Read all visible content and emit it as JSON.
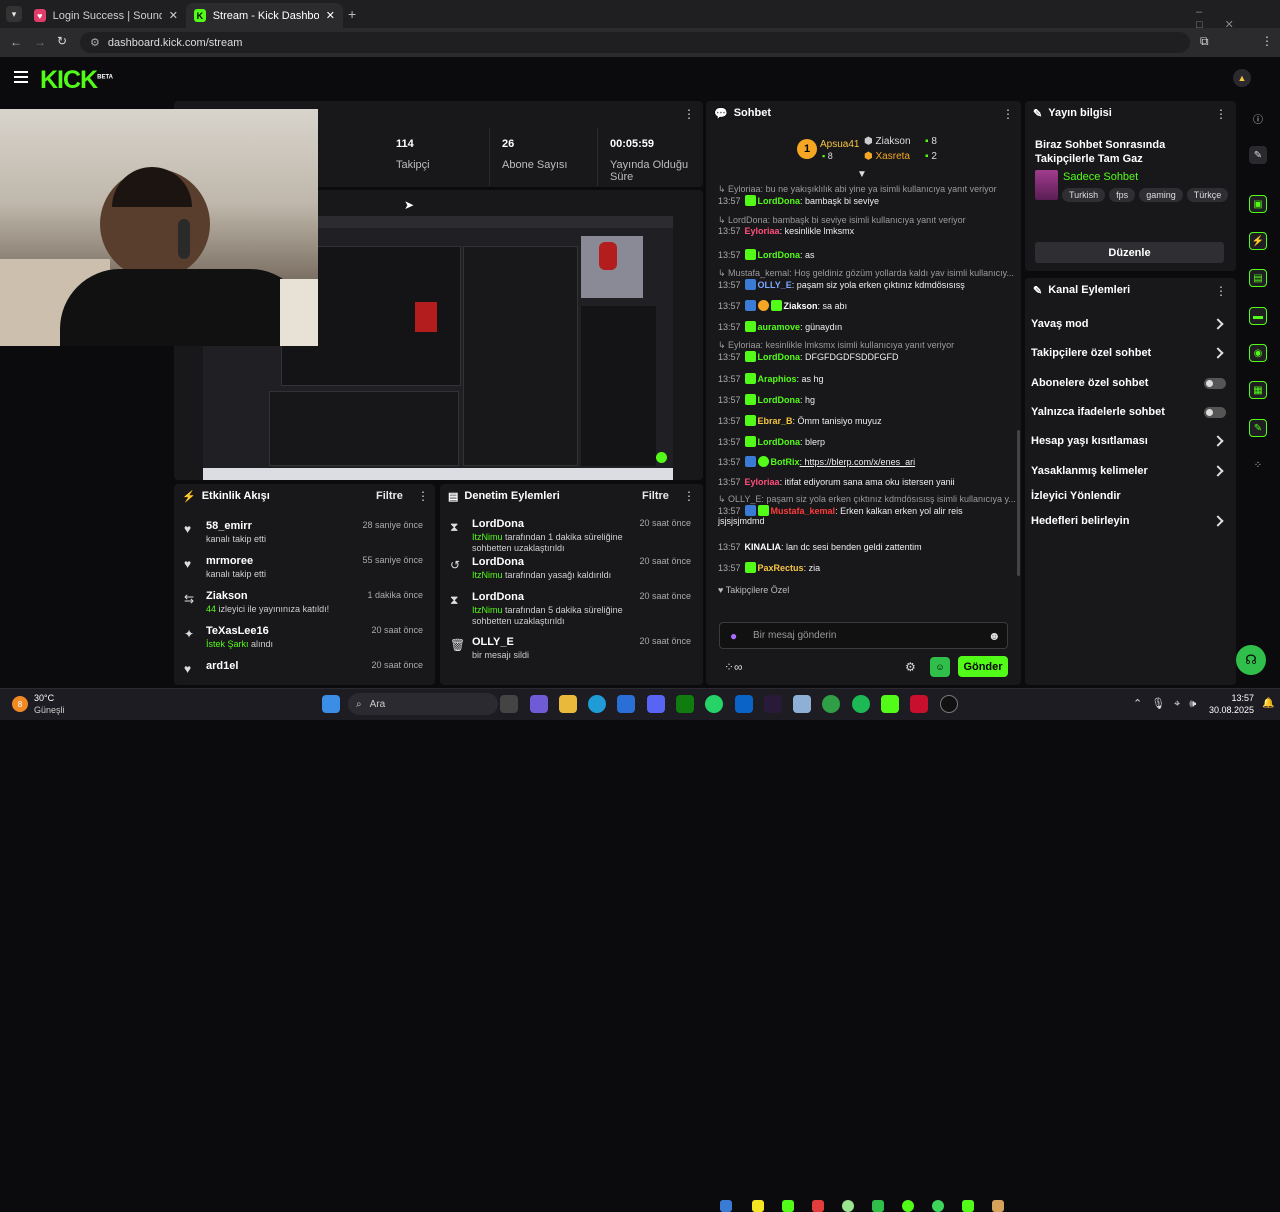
{
  "browser": {
    "tabs": [
      {
        "title": "Login Success | Soundboard Bro"
      },
      {
        "title": "Stream - Kick Dashboard"
      }
    ],
    "url": "dashboard.kick.com/stream"
  },
  "site": {
    "logo": "KICK",
    "logo_badge": "BETA"
  },
  "stats": [
    {
      "value": "114",
      "label": "Takipçi"
    },
    {
      "value": "26",
      "label": "Abone Sayısı"
    },
    {
      "value": "00:05:59",
      "label": "Yayında Olduğu Süre"
    }
  ],
  "activity": {
    "title": "Etkinlik Akışı",
    "filter": "Filtre",
    "items": [
      {
        "icon": "heart-icon",
        "name": "58_emirr",
        "time": "28 saniye önce",
        "desc": "kanalı takip etti",
        "highlight": ""
      },
      {
        "icon": "heart-icon",
        "name": "mrmoree",
        "time": "55 saniye önce",
        "desc": "kanalı takip etti",
        "highlight": ""
      },
      {
        "icon": "raid-icon",
        "name": "Ziakson",
        "time": "1 dakika önce",
        "desc": "izleyici ile yayınınıza katıldı!",
        "highlight": "44"
      },
      {
        "icon": "sparkle-icon",
        "name": "TeXasLee16",
        "time": "20 saat önce",
        "desc": "alındı",
        "highlight": "İstek Şarkı"
      },
      {
        "icon": "heart-icon",
        "name": "ard1el",
        "time": "20 saat önce",
        "desc": "",
        "highlight": ""
      }
    ]
  },
  "moderation": {
    "title": "Denetim Eylemleri",
    "filter": "Filtre",
    "items": [
      {
        "icon": "hourglass-icon",
        "name": "LordDona",
        "time": "20 saat önce",
        "highlight": "ItzNimu",
        "desc": "tarafından 1 dakika süreliğine sohbetten uzaklaştırıldı"
      },
      {
        "icon": "undo-icon",
        "name": "LordDona",
        "time": "20 saat önce",
        "highlight": "ItzNimu",
        "desc": "tarafından yasağı kaldırıldı"
      },
      {
        "icon": "hourglass-icon",
        "name": "LordDona",
        "time": "20 saat önce",
        "highlight": "ItzNimu",
        "desc": "tarafından 5 dakika süreliğine sohbetten uzaklaştırıldı"
      },
      {
        "icon": "trash-icon",
        "name": "OLLY_E",
        "time": "20 saat önce",
        "highlight": "",
        "desc": "bir mesajı sildi"
      }
    ]
  },
  "chat": {
    "title": "Sohbet",
    "leaderboard": [
      {
        "rank": "1",
        "name": "Apsua41",
        "count": "8"
      },
      {
        "rank": "",
        "name": "Ziakson",
        "count": "8"
      },
      {
        "rank": "",
        "name": "Xasreta",
        "count": "2"
      }
    ],
    "messages": [
      {
        "reply": "Eyloriaa: bu ne yakışıklılık abi yine ya isimli kullanıcıya yanıt veriyor",
        "time": "13:57",
        "user": "LordDona",
        "color": "#53fc18",
        "text": ": bambaşk bi seviye"
      },
      {
        "reply": "LordDona: bambaşk bi seviye isimli kullanıcıya yanıt veriyor",
        "time": "13:57",
        "user": "Eyloriaa",
        "color": "#ff4f7a",
        "text": ": kesinlikle lmksmx"
      },
      {
        "reply": "",
        "time": "13:57",
        "user": "LordDona",
        "color": "#53fc18",
        "text": ": as"
      },
      {
        "reply": "Mustafa_kemal: Hoş geldiniz gözüm yollarda kaldı yav isimli kullanıcıy...",
        "time": "13:57",
        "user": "OLLY_E",
        "color": "#7aa7ff",
        "text": ": paşam siz yola erken çıktınız kdmdösısısş"
      },
      {
        "reply": "",
        "time": "13:57",
        "user": "Ziakson",
        "color": "#ffffff",
        "text": ": sa abı"
      },
      {
        "reply": "",
        "time": "13:57",
        "user": "auramove",
        "color": "#53fc18",
        "text": ": günaydın"
      },
      {
        "reply": "Eyloriaa: kesinlikle lmksmx isimli kullanıcıya yanıt veriyor",
        "time": "13:57",
        "user": "LordDona",
        "color": "#53fc18",
        "text": ": DFGFDGDFSDDFGFD"
      },
      {
        "reply": "",
        "time": "13:57",
        "user": "Araphios",
        "color": "#53fc18",
        "text": ": as hg"
      },
      {
        "reply": "",
        "time": "13:57",
        "user": "LordDona",
        "color": "#53fc18",
        "text": ": hg"
      },
      {
        "reply": "",
        "time": "13:57",
        "user": "Ebrar_B",
        "color": "#f5c542",
        "text": ": Ömm tanisiyo muyuz"
      },
      {
        "reply": "",
        "time": "13:57",
        "user": "LordDona",
        "color": "#53fc18",
        "text": ": blerp"
      },
      {
        "reply": "",
        "time": "13:57",
        "user": "BotRix",
        "color": "#53fc18",
        "text": ": https://blerp.com/x/enes_ari"
      },
      {
        "reply": "",
        "time": "13:57",
        "user": "Eyloriaa",
        "color": "#ff4f7a",
        "text": ": itifat ediyorum sana ama oku istersen yanii"
      },
      {
        "reply": "OLLY_E: paşam siz yola erken çıktınız kdmdösısısş isimli kullanıcıya y...",
        "time": "13:57",
        "user": "Mustafa_kemal",
        "color": "#ff3b3b",
        "text": ": Erken kalkan erken yol alir reis jsjsjsjmdmd"
      },
      {
        "reply": "",
        "time": "13:57",
        "user": "KINALIA",
        "color": "#ffffff",
        "text": ": lan dc sesi benden geldi zattentim"
      },
      {
        "reply": "",
        "time": "13:57",
        "user": "PaxRectus",
        "color": "#f5c542",
        "text": ": zia"
      }
    ],
    "followers_only": "Takipçilere Özel",
    "input_placeholder": "Bir mesaj gönderin",
    "send": "Gönder"
  },
  "stream_info": {
    "title": "Yayın bilgisi",
    "stream_title": "Biraz Sohbet Sonrasında Takipçilerle Tam Gaz",
    "category": "Sadece Sohbet",
    "tags": [
      "Turkish",
      "fps",
      "gaming",
      "Türkçe"
    ],
    "edit": "Düzenle"
  },
  "channel_actions": {
    "title": "Kanal Eylemleri",
    "items": [
      {
        "label": "Yavaş mod",
        "type": "chevron"
      },
      {
        "label": "Takipçilere özel sohbet",
        "type": "chevron"
      },
      {
        "label": "Abonelere özel sohbet",
        "type": "toggle"
      },
      {
        "label": "Yalnızca ifadelerle sohbet",
        "type": "toggle"
      },
      {
        "label": "Hesap yaşı kısıtlaması",
        "type": "chevron"
      },
      {
        "label": "Yasaklanmış kelimeler",
        "type": "chevron"
      },
      {
        "label": "İzleyici Yönlendir",
        "type": "none"
      },
      {
        "label": "Hedefleri belirleyin",
        "type": "chevron"
      }
    ]
  },
  "taskbar": {
    "weather_temp": "30°C",
    "weather_desc": "Güneşli",
    "search": "Ara",
    "time": "13:57",
    "date": "30.08.2025",
    "notif_count": "8"
  },
  "colors": {
    "accent": "#53fc18",
    "panel": "#18181b",
    "bg": "#0b0b0d"
  }
}
